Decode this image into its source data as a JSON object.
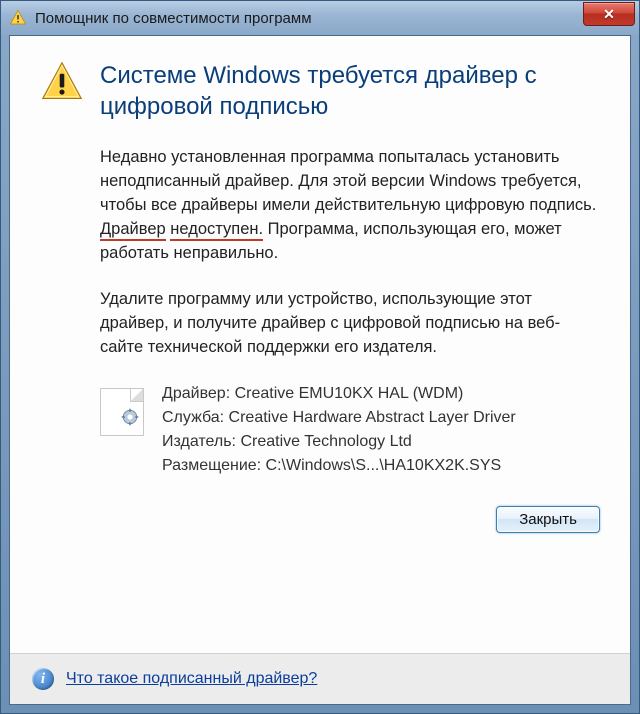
{
  "window": {
    "title": "Помощник по совместимости программ"
  },
  "heading": "Системе Windows требуется драйвер с цифровой подписью",
  "para1_a": "Недавно установленная программа попыталась установить неподписанный драйвер. Для этой версии Windows требуется, чтобы все драйверы имели действительную цифровую подпись. ",
  "para1_u1": "Драйвер",
  "para1_u2": "недоступен.",
  "para1_b": " Программа, использующая его, может работать неправильно.",
  "para2": "Удалите программу или устройство, использующие этот драйвер, и получите драйвер с цифровой подписью на веб-сайте технической поддержки его издателя.",
  "details": {
    "driver_label": "Драйвер: ",
    "driver_value": "Creative EMU10KX HAL (WDM)",
    "service_label": "Служба: ",
    "service_value": "Creative Hardware Abstract Layer Driver",
    "publisher_label": "Издатель: ",
    "publisher_value": "Creative Technology Ltd",
    "location_label": "Размещение: ",
    "location_value": "C:\\Windows\\S...\\HA10KX2K.SYS"
  },
  "buttons": {
    "close": "Закрыть"
  },
  "footer": {
    "link": "Что такое подписанный драйвер?"
  }
}
